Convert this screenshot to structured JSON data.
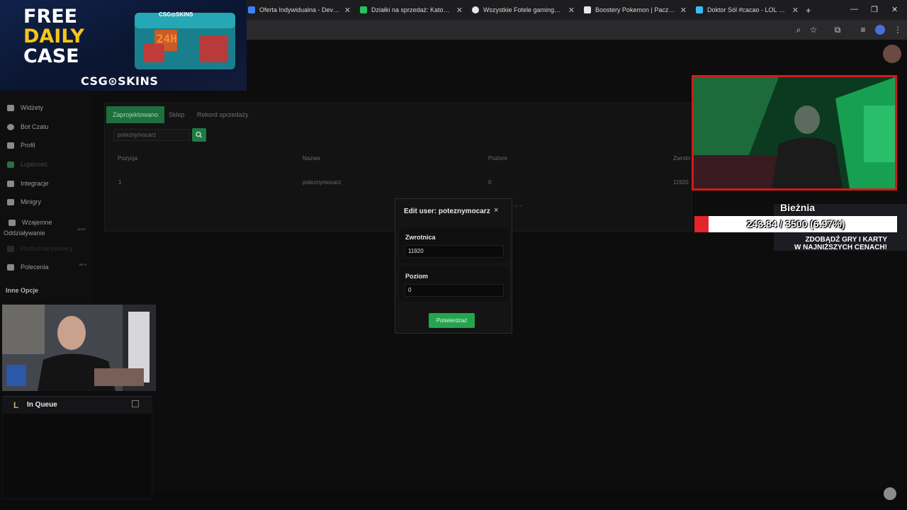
{
  "browser": {
    "tabs": [
      {
        "title": "Oferta Indywidualna - Develoc",
        "favicon_color": "#3b82f6"
      },
      {
        "title": "Działki na sprzedaż: Katowice, ś",
        "favicon_color": "#22c55e"
      },
      {
        "title": "Wszystkie Fotele gamingowe |",
        "favicon_color": "#e5e7eb"
      },
      {
        "title": "Boostery Pokemon | Paczki kar",
        "favicon_color": "#e5e7eb"
      },
      {
        "title": "Doktor Sól #cacao - LOL STATS",
        "favicon_color": "#38bdf8"
      }
    ],
    "new_tab": "+",
    "toolbar_icons": [
      "zoom-icon",
      "star-icon",
      "extensions-icon",
      "media-icon",
      "profile-icon",
      "menu-icon"
    ]
  },
  "sidebar": {
    "items": [
      {
        "label": "Widżety"
      },
      {
        "label": "Bot Czatu"
      },
      {
        "label": "Profil"
      },
      {
        "label": "Lojalność"
      },
      {
        "label": "Integracje"
      },
      {
        "label": "Minigry"
      },
      {
        "label": "Wzajemne Oddziaływanie",
        "badge": "NOWY"
      },
      {
        "label": "Podsubskrywowcy"
      },
      {
        "label": "Polecenia",
        "badge": "BETA"
      }
    ],
    "section_title": "Inne Opcje"
  },
  "panel": {
    "tabs": [
      "Zaprojektowano",
      "Sklep",
      "Rekord sprzedaży"
    ],
    "search_value": "poteznymocarz",
    "columns": [
      "Pozycja",
      "Nazwa",
      "Poziom",
      "Zwrotn"
    ],
    "rows": [
      {
        "position": "1",
        "name": "poteznymocarz",
        "level": "0",
        "return": "11920"
      }
    ],
    "pager": "«   »"
  },
  "modal": {
    "title": "Edit user: poteznymocarz",
    "close": "×",
    "fields": [
      {
        "label": "Zwrotnica",
        "value": "11920"
      },
      {
        "label": "Poziom",
        "value": "0"
      }
    ],
    "confirm": "Potwierdzać"
  },
  "overlays": {
    "promo": {
      "line1": "FREE",
      "line2": "DAILY",
      "line3": "CASE",
      "brand": "CSG⊙SKINS",
      "case_label": "24H",
      "case_brand": "CSG⊙SKINS"
    },
    "goal": {
      "title": "Bieżnia",
      "label": "243.84 / 3500 (6.97%)",
      "progress_fraction": 0.0697
    },
    "ad": {
      "line1": "ZDOBĄDŹ GRY I KARTY",
      "line2": "W NAJNIŻSZYCH CENACH!"
    },
    "queue": {
      "icon": "L",
      "label": "In Queue"
    }
  },
  "colors": {
    "accent_green": "#26a34f",
    "progress_red": "#e3242b",
    "cam_border_red": "#d21a1a"
  }
}
